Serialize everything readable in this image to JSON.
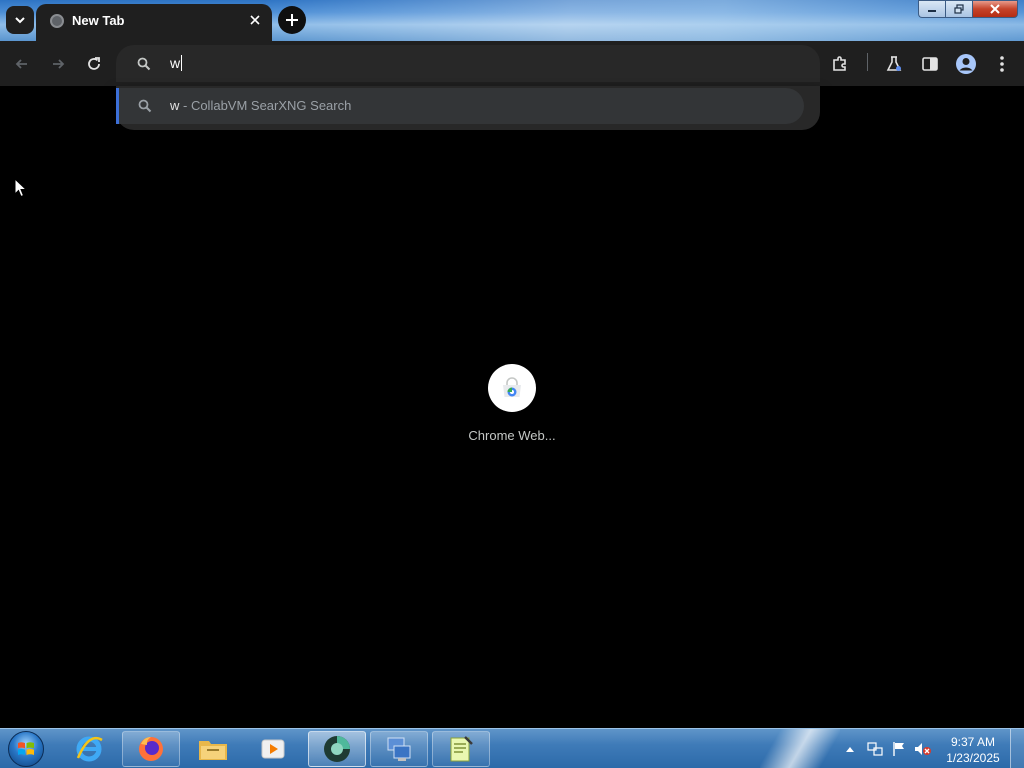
{
  "browser": {
    "tab": {
      "title": "New Tab",
      "favicon": "globe-icon",
      "close_icon": "close-icon"
    },
    "new_tab_icon": "plus-icon",
    "tab_search_icon": "chevron-down-icon",
    "window_controls": [
      "minimize-icon",
      "maximize-icon",
      "close-icon"
    ]
  },
  "toolbar": {
    "back_icon": "arrow-left-icon",
    "forward_icon": "arrow-right-icon",
    "reload_icon": "reload-icon",
    "omnibox": {
      "icon": "search-icon",
      "value": "w"
    },
    "right_icons": [
      "extensions-icon",
      "labs-flask-icon",
      "side-panel-icon",
      "profile-avatar-icon",
      "kebab-menu-icon"
    ]
  },
  "dropdown": {
    "suggestions": [
      {
        "icon": "search-icon",
        "query": "w",
        "suffix": " - CollabVM SearXNG Search"
      }
    ]
  },
  "page": {
    "shortcut": {
      "label": "Chrome Web...",
      "icon": "chrome-web-store-icon"
    }
  },
  "taskbar": {
    "start_icon": "windows-start-icon",
    "apps": [
      {
        "icon": "internet-explorer-icon",
        "state": "normal"
      },
      {
        "icon": "firefox-icon",
        "state": "running"
      },
      {
        "icon": "file-explorer-icon",
        "state": "normal"
      },
      {
        "icon": "media-player-icon",
        "state": "normal"
      },
      {
        "icon": "chrome-dark-icon",
        "state": "active"
      },
      {
        "icon": "network-computer-icon",
        "state": "running"
      },
      {
        "icon": "notepad-icon",
        "state": "running"
      }
    ],
    "tray_icons": [
      "show-hidden-icons-arrow",
      "network-icon",
      "action-center-flag-icon",
      "volume-muted-icon"
    ],
    "clock": {
      "time": "9:37 AM",
      "date": "1/23/2025"
    }
  },
  "colors": {
    "background": "#000000",
    "toolbar": "#1f1f1f",
    "omnibox": "#282828",
    "suggestion_highlight": "#333537",
    "accent": "#3c6fd8"
  }
}
